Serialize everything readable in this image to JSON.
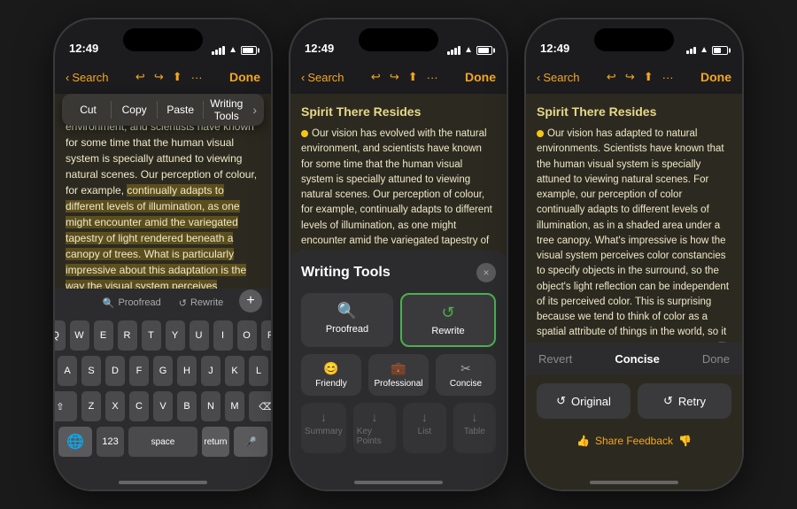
{
  "phone1": {
    "time": "12:49",
    "nav": {
      "back": "Search",
      "done": "Done"
    },
    "context_menu": {
      "items": [
        "Cut",
        "Copy",
        "Paste",
        "Writing Tools"
      ]
    },
    "content": "Our vision has evolved with the natural environment, and scientists have known for some time that the human visual system is specially attuned to viewing natural scenes. Our perception of colour, for example, continually adapts to different levels of illumination, as one might encounter amid the variegated tapestry of light rendered beneath a canopy of trees. What is particularly impressive about this adaptation is the way the visual system perceives constancies in colour in order to specify objects in the surround, such that the composition of light an object reflects can be literally independent of the colour perceive it to be. This fact strikes most",
    "proofread_label": "Proofread",
    "rewrite_label": "Rewrite",
    "keyboard": {
      "rows": [
        [
          "Q",
          "W",
          "E",
          "R",
          "T",
          "Y",
          "U",
          "I",
          "O",
          "P"
        ],
        [
          "A",
          "S",
          "D",
          "F",
          "G",
          "H",
          "J",
          "K",
          "L"
        ],
        [
          "⇧",
          "Z",
          "X",
          "C",
          "V",
          "B",
          "N",
          "M",
          "⌫"
        ],
        [
          "123",
          "space",
          "return"
        ]
      ]
    }
  },
  "phone2": {
    "time": "12:49",
    "nav": {
      "back": "Search",
      "done": "Done"
    },
    "title": "Spirit There Resides",
    "content": "Our vision has evolved with the natural environment, and scientists have known for some time that the human visual system is specially attuned to viewing natural scenes. Our perception of colour, for example, continually adapts to different levels of illumination, as one might encounter amid the variegated tapestry of light rendered beneath a canopy of trees. What is particularly impressive about this adaptation is the way the visual system perceives constancies in colour in order to specify objects in the surround, such tho the composition of light an object reflects",
    "writing_tools": {
      "title": "Writing Tools",
      "close_label": "×",
      "top_buttons": [
        {
          "label": "Proofread",
          "icon": "🔍",
          "highlighted": false
        },
        {
          "label": "Rewrite",
          "icon": "↺",
          "highlighted": true
        }
      ],
      "middle_buttons": [
        {
          "label": "Friendly",
          "icon": "😊"
        },
        {
          "label": "Professional",
          "icon": "💼"
        },
        {
          "label": "Concise",
          "icon": "✂️"
        }
      ],
      "bottom_buttons": [
        {
          "label": "Summary",
          "icon": "↓"
        },
        {
          "label": "Key Points",
          "icon": "↓"
        },
        {
          "label": "List",
          "icon": "↓"
        },
        {
          "label": "Table",
          "icon": "↓"
        }
      ]
    }
  },
  "phone3": {
    "time": "12:49",
    "nav": {
      "back": "Search",
      "done": "Done"
    },
    "title": "Spirit There Resides",
    "content": "Our vision has adapted to natural environments. Scientists have known that the human visual system is specially attuned to viewing natural scenes. For example, our perception of color continually adapts to different levels of illumination, as in a shaded area under a tree canopy. What's impressive is how the visual system perceives color constancies to specify objects in the surround, so the object's light reflection can be independent of its perceived color. This is surprising because we tend to think of color as a spatial attribute of things in the world, so it must correspond to light reflected over a specific area. But the color we attribute to objects often remains unwaveringly consistent despite variations in local illumination. For instance, areas that look green typically",
    "rewrite_options": [
      "Revert",
      "Concise",
      "Done"
    ],
    "active_option": "Concise",
    "action_buttons": [
      "Original",
      "Retry"
    ],
    "feedback_label": "Share Feedback"
  }
}
